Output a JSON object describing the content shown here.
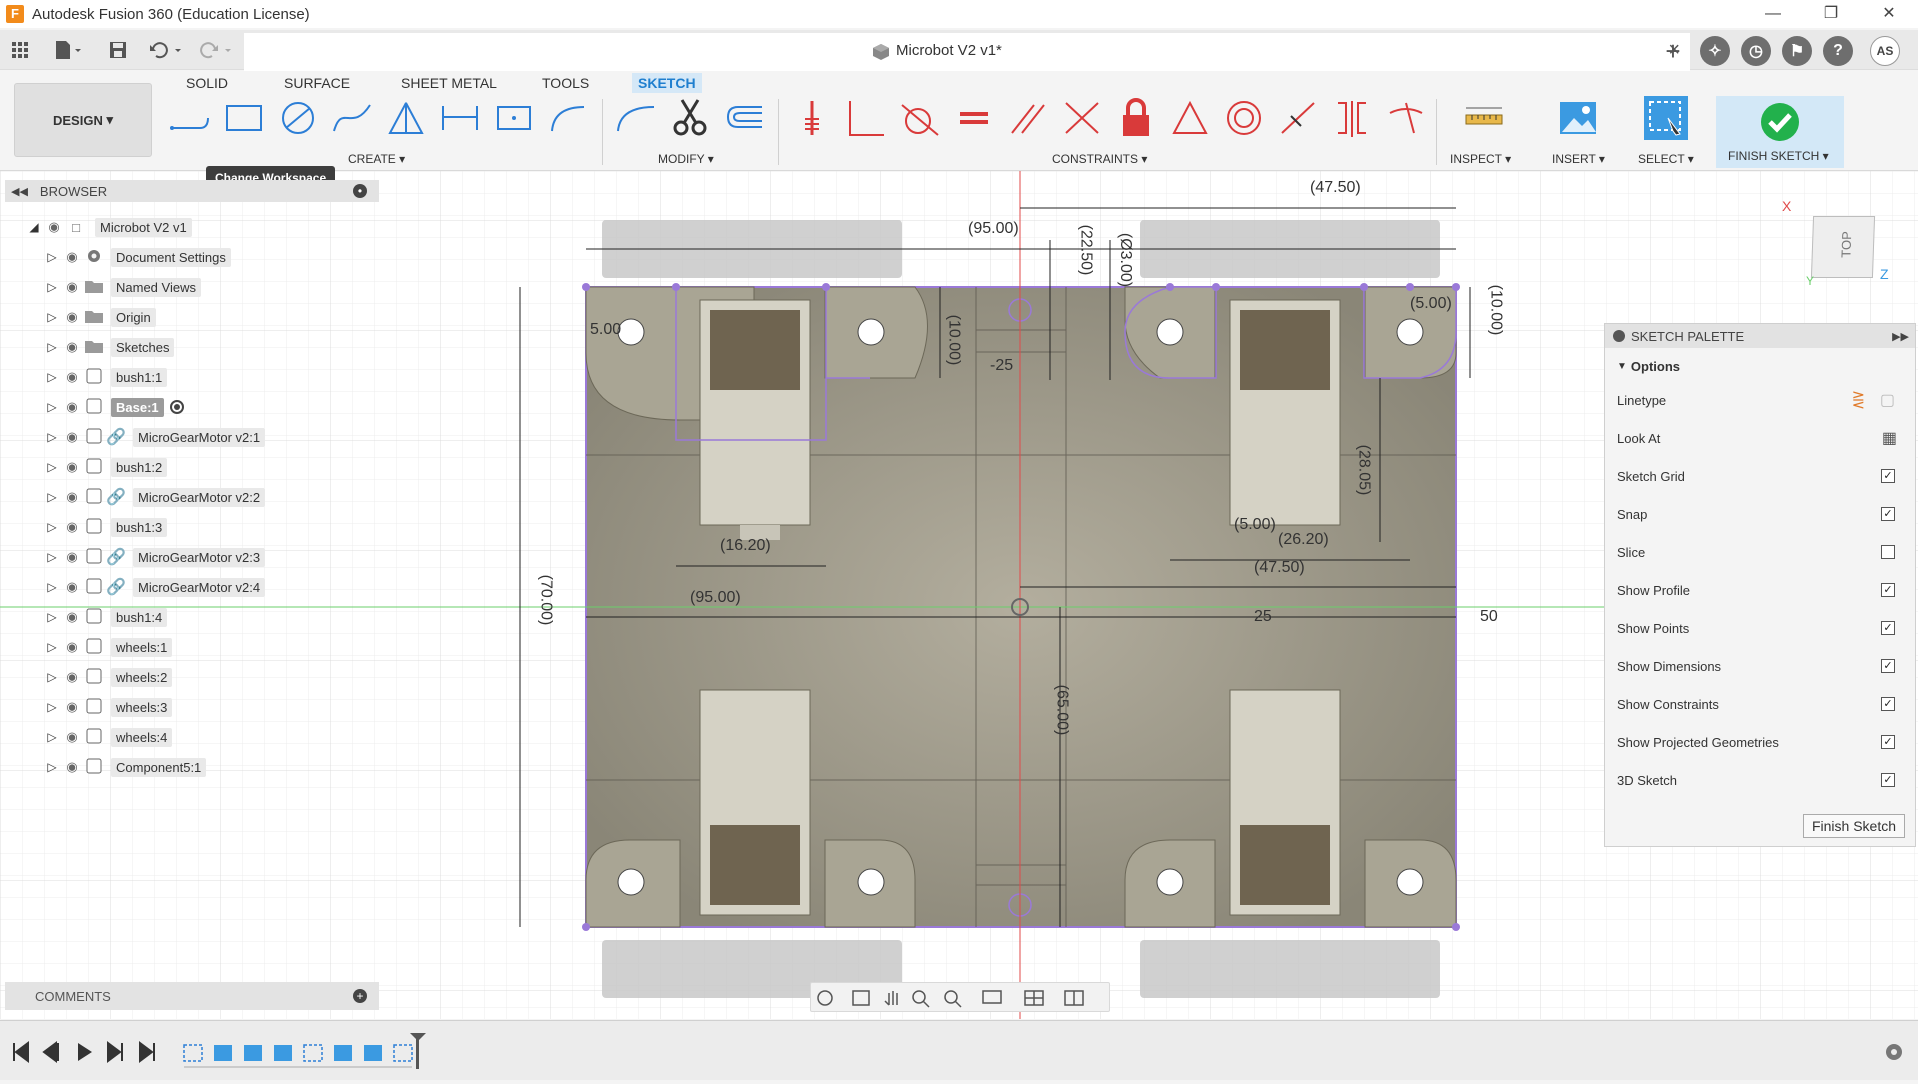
{
  "app": {
    "title": "Autodesk Fusion 360 (Education License)",
    "logo_letter": "F",
    "user_initials": "AS"
  },
  "document": {
    "title": "Microbot V2 v1*"
  },
  "ribbon": {
    "workspace": "DESIGN",
    "tabs": [
      "SOLID",
      "SURFACE",
      "SHEET METAL",
      "TOOLS",
      "SKETCH"
    ],
    "active_tab": "SKETCH",
    "groups": {
      "create": "CREATE",
      "modify": "MODIFY",
      "constraints": "CONSTRAINTS",
      "inspect": "INSPECT",
      "insert": "INSERT",
      "select": "SELECT",
      "finish": "FINISH SKETCH"
    },
    "tooltip": "Change Workspace"
  },
  "browser": {
    "title": "BROWSER",
    "root": "Microbot V2 v1",
    "items": [
      {
        "label": "Document Settings",
        "icon": "gear-icon"
      },
      {
        "label": "Named Views",
        "icon": "folder-icon"
      },
      {
        "label": "Origin",
        "icon": "folder-icon"
      },
      {
        "label": "Sketches",
        "icon": "folder-icon"
      },
      {
        "label": "bush1:1",
        "icon": "component-icon"
      },
      {
        "label": "Base:1",
        "icon": "component-icon",
        "active": true
      },
      {
        "label": "MicroGearMotor v2:1",
        "icon": "linked-component-icon"
      },
      {
        "label": "bush1:2",
        "icon": "component-icon"
      },
      {
        "label": "MicroGearMotor v2:2",
        "icon": "linked-component-icon"
      },
      {
        "label": "bush1:3",
        "icon": "component-icon"
      },
      {
        "label": "MicroGearMotor v2:3",
        "icon": "linked-component-icon"
      },
      {
        "label": "MicroGearMotor v2:4",
        "icon": "linked-component-icon"
      },
      {
        "label": "bush1:4",
        "icon": "component-icon"
      },
      {
        "label": "wheels:1",
        "icon": "component-icon"
      },
      {
        "label": "wheels:2",
        "icon": "component-icon"
      },
      {
        "label": "wheels:3",
        "icon": "component-icon"
      },
      {
        "label": "wheels:4",
        "icon": "component-icon"
      },
      {
        "label": "Component5:1",
        "icon": "component-icon"
      }
    ]
  },
  "comments": {
    "title": "COMMENTS"
  },
  "sketch_palette": {
    "title": "SKETCH PALETTE",
    "section": "Options",
    "options": [
      {
        "label": "Linetype",
        "type": "icons"
      },
      {
        "label": "Look At",
        "type": "icon"
      },
      {
        "label": "Sketch Grid",
        "checked": true
      },
      {
        "label": "Snap",
        "checked": true
      },
      {
        "label": "Slice",
        "checked": false
      },
      {
        "label": "Show Profile",
        "checked": true
      },
      {
        "label": "Show Points",
        "checked": true
      },
      {
        "label": "Show Dimensions",
        "checked": true
      },
      {
        "label": "Show Constraints",
        "checked": true
      },
      {
        "label": "Show Projected Geometries",
        "checked": true
      },
      {
        "label": "3D Sketch",
        "checked": true
      }
    ],
    "finish_button": "Finish Sketch"
  },
  "viewcube": {
    "face": "TOP",
    "axis_x": "X",
    "axis_y": "Y",
    "axis_z": "Z"
  },
  "dimensions": {
    "top_width": "(47.50)",
    "overall_width": "(95.00)",
    "d1": "(22.50)",
    "d2": "(Ø3.00)",
    "d3": "(10.00)",
    "d4": "(10.00)",
    "d5": "5.00",
    "d6": "(5.00)",
    "d7": "-25",
    "d8": "(28.05)",
    "d9": "(5.00)",
    "d10": "(26.20)",
    "d11": "(16.20)",
    "d12": "(47.50)",
    "d13": "(95.00)",
    "d14": "(70.00)",
    "d15": "25",
    "d16": "50",
    "d17": "(65.00)"
  },
  "colors": {
    "accent": "#1f7fcf",
    "sketch_line": "#9a79d8",
    "finish_green": "#22b14c",
    "constraint_red": "#d93a3a"
  }
}
